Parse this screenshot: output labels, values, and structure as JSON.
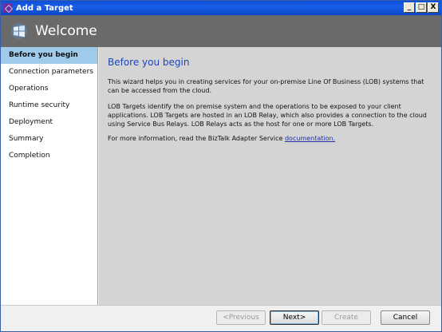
{
  "window": {
    "title": "Add a Target",
    "controls": {
      "minimize": "_",
      "maximize": "□",
      "close": "X"
    }
  },
  "header": {
    "title": "Welcome"
  },
  "sidebar": {
    "items": [
      {
        "label": "Before you begin",
        "active": true
      },
      {
        "label": "Connection parameters",
        "active": false
      },
      {
        "label": "Operations",
        "active": false
      },
      {
        "label": "Runtime security",
        "active": false
      },
      {
        "label": "Deployment",
        "active": false
      },
      {
        "label": "Summary",
        "active": false
      },
      {
        "label": "Completion",
        "active": false
      }
    ]
  },
  "content": {
    "title": "Before you begin",
    "paragraph1": "This wizard helps you in creating services for your on-premise Line Of Business (LOB) systems that can be accessed from the cloud.",
    "paragraph2": "LOB Targets identify the on premise system and the operations to be exposed to your client applications.  LOB Targets are hosted in an LOB Relay, which also provides a connection to the cloud using Service Bus Relays. LOB Relays acts as the host for one or more LOB Targets.",
    "paragraph3_prefix": "For more information, read the BizTalk Adapter Service ",
    "paragraph3_link": "documentation."
  },
  "footer": {
    "previous": "<Previous",
    "next": "Next>",
    "create": "Create",
    "cancel": "Cancel"
  },
  "colors": {
    "titlebar": "#0b4fd6",
    "header": "#6a6a6a",
    "sidebar_active": "#9fcaea",
    "content_bg": "#d4d4d4",
    "title_blue": "#1f46b8"
  },
  "icons": {
    "app": "visual-studio-icon",
    "header": "windows-azure-logo-icon"
  }
}
